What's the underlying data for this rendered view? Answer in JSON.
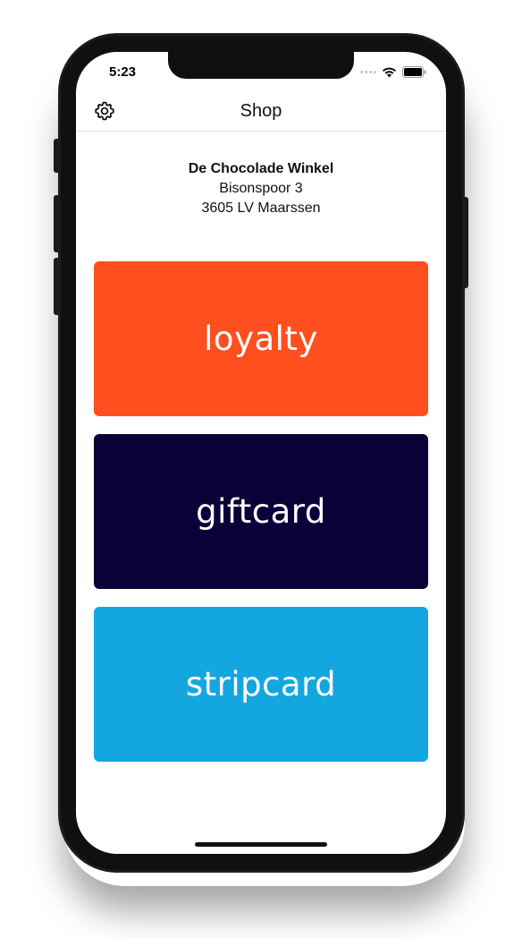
{
  "status_bar": {
    "time": "5:23"
  },
  "nav": {
    "title": "Shop",
    "settings_icon": "gear-icon"
  },
  "shop": {
    "name": "De Chocolade Winkel",
    "address_line1": "Bisonspoor 3",
    "address_line2": "3605 LV Maarssen"
  },
  "cards": [
    {
      "label": "loyalty",
      "color": "#ff4f1e"
    },
    {
      "label": "giftcard",
      "color": "#0c0038"
    },
    {
      "label": "stripcard",
      "color": "#14a7df"
    }
  ]
}
